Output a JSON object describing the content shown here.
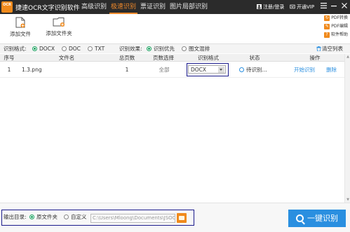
{
  "app": {
    "logo_text": "OCR",
    "title": "捷速OCR文字识别软件"
  },
  "tabs": [
    {
      "label": "高级识别",
      "active": false
    },
    {
      "label": "极速识别",
      "active": true
    },
    {
      "label": "票证识别",
      "active": false
    },
    {
      "label": "图片局部识别",
      "active": false
    }
  ],
  "window_controls": {
    "login": "注册/登录",
    "vip": "开通VIP",
    "menu_icon": "menu-icon",
    "minimize_icon": "minimize-icon",
    "close_icon": "close-icon"
  },
  "toolbar": {
    "add_file": "添加文件",
    "add_folder": "添加文件夹",
    "side": {
      "pdf_convert": "PDF转换",
      "pdf_edit": "PDF编辑",
      "help": "软件帮助"
    }
  },
  "options": {
    "format_label": "识别格式:",
    "formats": [
      {
        "label": "DOCX",
        "selected": true
      },
      {
        "label": "DOC",
        "selected": false
      },
      {
        "label": "TXT",
        "selected": false
      }
    ],
    "effect_label": "识别效果:",
    "effects": [
      {
        "label": "识别优先",
        "selected": true
      },
      {
        "label": "图文混排",
        "selected": false
      }
    ],
    "clear_list": "清空列表"
  },
  "table": {
    "headers": [
      "序号",
      "文件名",
      "总页数",
      "页数选择",
      "识别格式",
      "状态",
      "操作"
    ],
    "rows": [
      {
        "index": "1",
        "filename": "1.3.png",
        "pages": "1",
        "page_select": "全部",
        "format": "DOCX",
        "status": "待识别...",
        "start": "开始识别",
        "delete": "删除"
      }
    ]
  },
  "bottom": {
    "output_label": "输出目录:",
    "option_source": "原文件夹",
    "option_custom": "自定义",
    "source_selected": true,
    "path": "C:\\Users\\Mloong\\Documents\\JSOC",
    "ocr_button": "一键识别"
  },
  "colors": {
    "titlebar": "#2b2b2b",
    "accent_orange": "#f08a1c",
    "accent_blue": "#2a8fe0",
    "radio_green": "#1aa260",
    "highlight_frame": "#1a1a8c"
  }
}
